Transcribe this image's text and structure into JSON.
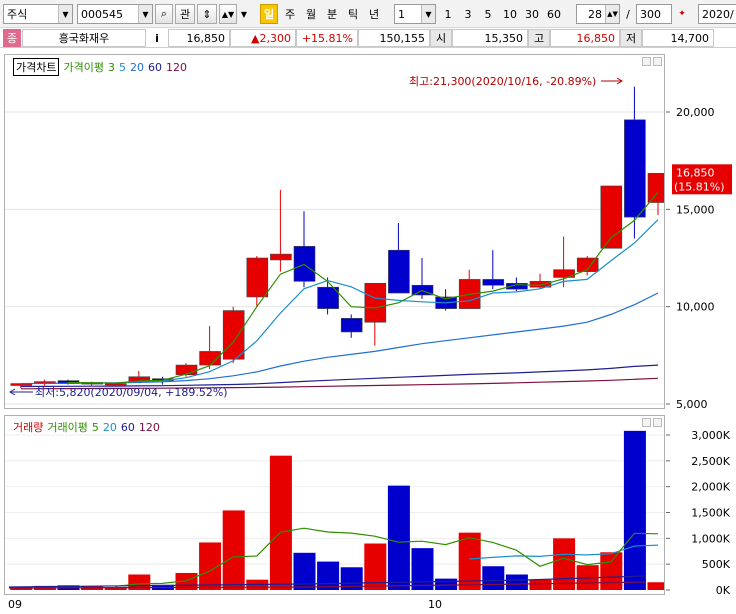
{
  "toolbar": {
    "market": "주식",
    "code": "000545",
    "btn_search": "⌕",
    "btn_interest": "관",
    "btn_day": "일",
    "btn_week": "주",
    "btn_month": "월",
    "btn_minute": "분",
    "btn_tick": "틱",
    "btn_year": "년",
    "period_select": "1",
    "p1": "1",
    "p3": "3",
    "p5": "5",
    "p10": "10",
    "p30": "30",
    "p60": "60",
    "count": "28",
    "slash": "/",
    "total": "300",
    "date": "2020/"
  },
  "quote": {
    "badge": "종",
    "name": "흥국화재우",
    "info": "i",
    "price": "16,850",
    "change": "▲2,300",
    "pct": "+15.81%",
    "volume": "150,155",
    "open_label": "시",
    "open": "15,350",
    "high_label": "고",
    "high": "16,850",
    "low_label": "저",
    "low": "14,700"
  },
  "price_pane": {
    "title": "가격차트",
    "ma_label": "가격이평",
    "ma_periods": [
      "3",
      "5",
      "20",
      "60",
      "120"
    ],
    "high_annotation": "최고:21,300(2020/10/16, -20.89%)",
    "low_annotation": "최저:5,820(2020/09/04, +189.52%)",
    "last_price_tag": "16,850",
    "last_pct_tag": "(15.81%)",
    "y_ticks": [
      "20,000",
      "15,000",
      "10,000",
      "5,000"
    ]
  },
  "volume_pane": {
    "title": "거래량",
    "ma_label": "거래이평",
    "ma_periods": [
      "5",
      "20",
      "60",
      "120"
    ],
    "y_ticks": [
      "3,000K",
      "2,500K",
      "2,000K",
      "1,500K",
      "1,000K",
      "500K",
      "0K"
    ]
  },
  "x_axis": {
    "labels": [
      "09",
      "10"
    ]
  },
  "colors": {
    "up": "#e60000",
    "down": "#0000cc",
    "ma3": "#2f8f00",
    "ma5": "#1c8ecf",
    "ma20": "#1f6fd0",
    "ma60": "#202090",
    "ma120": "#801040"
  },
  "chart_data": {
    "type": "candlestick",
    "price_min": 5000,
    "price_max": 22000,
    "volume_max": 3100000,
    "candles": [
      {
        "o": 5950,
        "h": 6050,
        "l": 5820,
        "c": 6050,
        "v": 60000
      },
      {
        "o": 6050,
        "h": 6250,
        "l": 5950,
        "c": 6150,
        "v": 80000
      },
      {
        "o": 6200,
        "h": 6250,
        "l": 6000,
        "c": 6050,
        "v": 90000
      },
      {
        "o": 6050,
        "h": 6150,
        "l": 5950,
        "c": 6100,
        "v": 70000
      },
      {
        "o": 6050,
        "h": 6100,
        "l": 5950,
        "c": 6050,
        "v": 50000
      },
      {
        "o": 6150,
        "h": 6700,
        "l": 6100,
        "c": 6400,
        "v": 300000
      },
      {
        "o": 6300,
        "h": 6400,
        "l": 6000,
        "c": 6200,
        "v": 100000
      },
      {
        "o": 6500,
        "h": 7100,
        "l": 6400,
        "c": 7000,
        "v": 330000
      },
      {
        "o": 7000,
        "h": 9000,
        "l": 6800,
        "c": 7700,
        "v": 920000
      },
      {
        "o": 7300,
        "h": 10000,
        "l": 7100,
        "c": 9800,
        "v": 1540000
      },
      {
        "o": 10500,
        "h": 12600,
        "l": 10000,
        "c": 12500,
        "v": 200000
      },
      {
        "o": 12400,
        "h": 16000,
        "l": 11800,
        "c": 12700,
        "v": 2600000
      },
      {
        "o": 13100,
        "h": 14900,
        "l": 11000,
        "c": 11300,
        "v": 720000
      },
      {
        "o": 11000,
        "h": 11500,
        "l": 9600,
        "c": 9900,
        "v": 550000
      },
      {
        "o": 9400,
        "h": 9600,
        "l": 8400,
        "c": 8700,
        "v": 440000
      },
      {
        "o": 9200,
        "h": 11200,
        "l": 8000,
        "c": 11200,
        "v": 900000
      },
      {
        "o": 12900,
        "h": 14300,
        "l": 10800,
        "c": 10700,
        "v": 2020000
      },
      {
        "o": 11100,
        "h": 12500,
        "l": 10400,
        "c": 10600,
        "v": 810000
      },
      {
        "o": 10500,
        "h": 10900,
        "l": 9800,
        "c": 9900,
        "v": 220000
      },
      {
        "o": 9900,
        "h": 11900,
        "l": 9900,
        "c": 11400,
        "v": 1110000
      },
      {
        "o": 11400,
        "h": 12900,
        "l": 10900,
        "c": 11100,
        "v": 460000
      },
      {
        "o": 11200,
        "h": 11500,
        "l": 10800,
        "c": 10900,
        "v": 300000
      },
      {
        "o": 11000,
        "h": 11700,
        "l": 10900,
        "c": 11300,
        "v": 200000
      },
      {
        "o": 11500,
        "h": 13600,
        "l": 11000,
        "c": 11900,
        "v": 1000000
      },
      {
        "o": 11800,
        "h": 12600,
        "l": 11600,
        "c": 12500,
        "v": 480000
      },
      {
        "o": 13000,
        "h": 16200,
        "l": 13000,
        "c": 16200,
        "v": 730000
      },
      {
        "o": 19600,
        "h": 21300,
        "l": 13500,
        "c": 14600,
        "v": 3080000
      },
      {
        "o": 15350,
        "h": 16850,
        "l": 14700,
        "c": 16850,
        "v": 150155
      }
    ],
    "ma3": [
      null,
      null,
      6100,
      6100,
      6070,
      6180,
      6220,
      6530,
      6970,
      8170,
      10000,
      11670,
      12170,
      11300,
      10000,
      9930,
      10200,
      10830,
      10400,
      10630,
      10800,
      11130,
      11100,
      11430,
      11900,
      13530,
      14430,
      15880
    ],
    "ma5": [
      null,
      null,
      null,
      null,
      6080,
      6150,
      6180,
      6350,
      6660,
      7220,
      8240,
      9670,
      10920,
      11340,
      11020,
      10440,
      10320,
      10250,
      10200,
      10300,
      10700,
      10760,
      10920,
      11300,
      11400,
      12350,
      13270,
      14470
    ],
    "ma20": [
      6050,
      6060,
      6070,
      6080,
      6090,
      6110,
      6140,
      6200,
      6300,
      6450,
      6650,
      6950,
      7200,
      7400,
      7550,
      7700,
      7900,
      8100,
      8250,
      8400,
      8550,
      8700,
      8850,
      9000,
      9200,
      9600,
      10100,
      10700
    ],
    "ma60": [
      5900,
      5905,
      5910,
      5915,
      5920,
      5930,
      5940,
      5960,
      5980,
      6000,
      6040,
      6100,
      6160,
      6220,
      6270,
      6320,
      6370,
      6420,
      6470,
      6520,
      6560,
      6600,
      6650,
      6700,
      6750,
      6830,
      6930,
      7000
    ],
    "ma120": [
      5780,
      5785,
      5790,
      5795,
      5800,
      5805,
      5810,
      5820,
      5830,
      5840,
      5855,
      5870,
      5890,
      5910,
      5930,
      5950,
      5970,
      5990,
      6010,
      6030,
      6060,
      6090,
      6120,
      6150,
      6180,
      6220,
      6270,
      6320
    ],
    "vma5": [
      null,
      null,
      null,
      null,
      70000,
      118000,
      128000,
      178000,
      364000,
      638000,
      658000,
      1118000,
      1196000,
      1122000,
      1102000,
      1042000,
      926000,
      944000,
      878000,
      1012000,
      922000,
      770000,
      458000,
      616000,
      492000,
      542000,
      1098000,
      1088000
    ],
    "vma20": [
      null,
      null,
      null,
      null,
      null,
      null,
      null,
      null,
      null,
      null,
      null,
      null,
      null,
      null,
      null,
      null,
      null,
      null,
      null,
      600000,
      630000,
      660000,
      650000,
      690000,
      680000,
      700000,
      850000,
      870000
    ],
    "vma60": [
      null,
      null,
      null,
      null,
      null,
      null,
      null,
      null,
      null,
      null,
      null,
      null,
      null,
      null,
      null,
      null,
      null,
      null,
      null,
      null,
      null,
      null,
      null,
      null,
      null,
      null,
      null,
      null
    ],
    "vma120": [
      null,
      null,
      null,
      null,
      null,
      null,
      null,
      null,
      null,
      null,
      null,
      null,
      null,
      null,
      null,
      null,
      null,
      null,
      null,
      null,
      null,
      null,
      null,
      null,
      null,
      null,
      null,
      null
    ]
  }
}
